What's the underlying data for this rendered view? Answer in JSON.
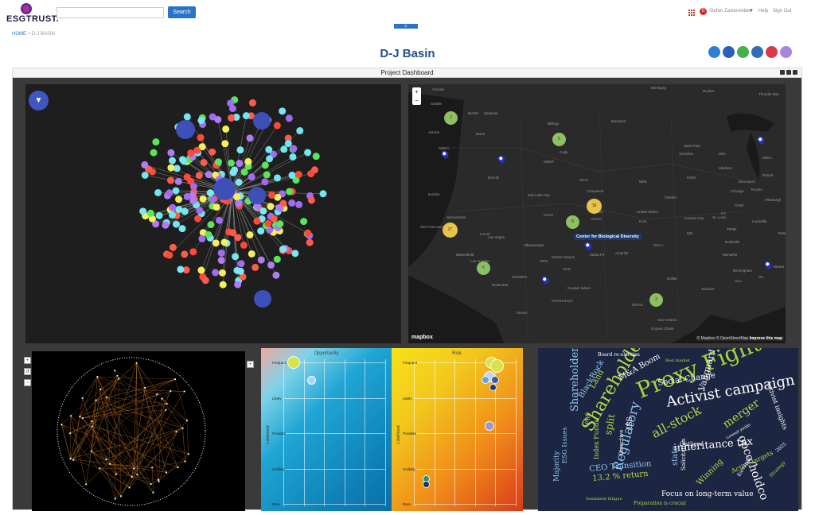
{
  "header": {
    "logo_text": "ESGTRUST.",
    "search_placeholder": "",
    "search_button": "Search",
    "notification_count": "0",
    "user_name": "Stefan Zasterweber",
    "help": "Help",
    "sign_out": "Sign Out",
    "menu_toggle": "≡"
  },
  "breadcrumb": {
    "home": "HOME",
    "separator": ">",
    "current": "D-J BASIN"
  },
  "page_title": "D-J Basin",
  "dashboard": {
    "title": "Project Dashboard"
  },
  "map": {
    "zoom_in": "+",
    "zoom_out": "−",
    "tooltip": "Center for Biological Diversity",
    "logo": "mapbox",
    "attribution_prefix": "© Mapbox © OpenStreetMap ",
    "attribution_link": "Improve this map",
    "clusters": [
      "2",
      "5",
      "18",
      "27",
      "8",
      "6",
      "3"
    ],
    "labels": [
      "Victoria",
      "Seattle",
      "Spokane",
      "Astoria",
      "WASH",
      "Billings",
      "Bismarck",
      "Winnipeg",
      "Dryden",
      "Thunder Bay",
      "Salem",
      "Cody",
      "Saint Paul",
      "Madison",
      "Detroit",
      "Eureka",
      "Salt Lake City",
      "Cheyenne",
      "Omaha",
      "Chicago",
      "Toronto",
      "Sacramento",
      "San Francisco",
      "Denver",
      "United States",
      "Kansas City",
      "St. Louis",
      "Louisville",
      "Bakersfield",
      "Las Vegas",
      "Albuquerque",
      "Amarillo",
      "Memphis",
      "Birmingham",
      "Atlanta",
      "Los Angeles",
      "Ensenada",
      "Ciudad Juárez",
      "Dallas",
      "San Antonio",
      "Corpus Christi",
      "Jackson",
      "Nashville",
      "Pittsburgh",
      "UTAH",
      "COLO",
      "CALIF",
      "ARIZ",
      "N.M.",
      "TEXAS",
      "MONT.",
      "IDAHO",
      "WYO.",
      "NEB.",
      "KAN.",
      "OKLA.",
      "MO.",
      "IOWA",
      "WIS.",
      "MICH.",
      "OHIO",
      "KY.",
      "TENN.",
      "ALA.",
      "GA.",
      "SONORA",
      "CHIHUAHUA",
      "Vermilion",
      "Devonport",
      "Boise",
      "Grand Canyon",
      "Tucson",
      "Santa Fe",
      "Raleigh"
    ]
  },
  "risk_chart": {
    "opportunity_title": "Opportunity",
    "risk_title": "Risk",
    "ylabel": "Likelihood",
    "ticks": [
      "Frequent",
      "Likely",
      "Possible",
      "Unlikely",
      "Rare"
    ],
    "opportunity_points": [
      {
        "likelihood": 5.0,
        "impact": 1.0,
        "size": 16,
        "color": "#d8e24a"
      },
      {
        "likelihood": 4.5,
        "impact": 1.9,
        "size": 11,
        "color": "#a8d6f4"
      }
    ],
    "risk_points": [
      {
        "likelihood": 5.0,
        "impact": 4.3,
        "size": 15,
        "color": "#d8e24a"
      },
      {
        "likelihood": 4.9,
        "impact": 4.6,
        "size": 17,
        "color": "#d8e24a"
      },
      {
        "likelihood": 4.6,
        "impact": 4.2,
        "size": 14,
        "color": "#bcd8f8"
      },
      {
        "likelihood": 4.5,
        "impact": 4.0,
        "size": 10,
        "color": "#6aa1e0"
      },
      {
        "likelihood": 4.5,
        "impact": 4.5,
        "size": 10,
        "color": "#3a5aa8"
      },
      {
        "likelihood": 4.3,
        "impact": 4.4,
        "size": 9,
        "color": "#1f3a7a"
      },
      {
        "likelihood": 3.2,
        "impact": 4.2,
        "size": 12,
        "color": "#9a98d6"
      },
      {
        "likelihood": 1.7,
        "impact": 1.1,
        "size": 9,
        "color": "#2a8e6e"
      },
      {
        "likelihood": 1.55,
        "impact": 1.1,
        "size": 9,
        "color": "#1b3360"
      }
    ]
  },
  "word_cloud": [
    {
      "text": "Proxy Fight",
      "size": 28,
      "color": "#a6d23b"
    },
    {
      "text": "Shareholders",
      "size": 22,
      "color": "#b6d84a"
    },
    {
      "text": "Activist campaign",
      "size": 18,
      "color": "#ffffff"
    },
    {
      "text": "Regulatory",
      "size": 16,
      "color": "#8fc7f0"
    },
    {
      "text": "Social Change",
      "size": 10,
      "color": "#ffffff"
    },
    {
      "text": "M&A Boom",
      "size": 10,
      "color": "#ffffff"
    },
    {
      "text": "Shareholder dividend",
      "size": 13,
      "color": "#8fc7f0"
    },
    {
      "text": "Vanguard",
      "size": 11,
      "color": "#ffffff"
    },
    {
      "text": "Land",
      "size": 10,
      "color": "#b6d84a"
    },
    {
      "text": "BlackRock",
      "size": 10,
      "color": "#8fc7f0"
    },
    {
      "text": "merger",
      "size": 14,
      "color": "#b6d84a"
    },
    {
      "text": "all-stock",
      "size": 16,
      "color": "#b6d84a"
    },
    {
      "text": "inheritance tax",
      "size": 13,
      "color": "#ffffff"
    },
    {
      "text": "opco/holdco",
      "size": 14,
      "color": "#ffffff"
    },
    {
      "text": "Activist insights",
      "size": 8,
      "color": "#ffffff"
    },
    {
      "text": "Board re-election",
      "size": 6,
      "color": "#ffffff"
    },
    {
      "text": "ESG Issues",
      "size": 8,
      "color": "#8fc7f0"
    },
    {
      "text": "Majority",
      "size": 9,
      "color": "#8fc7f0"
    },
    {
      "text": "CEO Transition",
      "size": 10,
      "color": "#8fc7f0"
    },
    {
      "text": "13.2 % return",
      "size": 10,
      "color": "#b6d84a"
    },
    {
      "text": "Index Funds",
      "size": 8,
      "color": "#b6d84a"
    },
    {
      "text": "Directive",
      "size": 7,
      "color": "#ffffff"
    },
    {
      "text": "ISS",
      "size": 9,
      "color": "#ffffff"
    },
    {
      "text": "Outliers",
      "size": 7,
      "color": "#ffffff"
    },
    {
      "text": "Winning",
      "size": 10,
      "color": "#b6d84a"
    },
    {
      "text": "Active targets",
      "size": 8,
      "color": "#b6d84a"
    },
    {
      "text": "Focus on long-term value",
      "size": 9,
      "color": "#ffffff"
    },
    {
      "text": "Preparation is crucial",
      "size": 6,
      "color": "#b6d84a"
    },
    {
      "text": "Sentiment fatigue",
      "size": 5,
      "color": "#b6d84a"
    },
    {
      "text": "split",
      "size": 12,
      "color": "#b6d84a"
    },
    {
      "text": "PRC",
      "size": 7,
      "color": "#b6d84a"
    },
    {
      "text": "Solicitation",
      "size": 7,
      "color": "#ffffff"
    },
    {
      "text": "Earnings",
      "size": 6,
      "color": "#ffffff"
    },
    {
      "text": "Strategy",
      "size": 6,
      "color": "#b6d84a"
    },
    {
      "text": "Best market",
      "size": 5,
      "color": "#b6d84a"
    },
    {
      "text": "Lowest yields",
      "size": 5,
      "color": "#ffffff"
    },
    {
      "text": "2025",
      "size": 6,
      "color": "#ffffff"
    },
    {
      "text": "state",
      "size": 10,
      "color": "#8fc7f0"
    }
  ]
}
